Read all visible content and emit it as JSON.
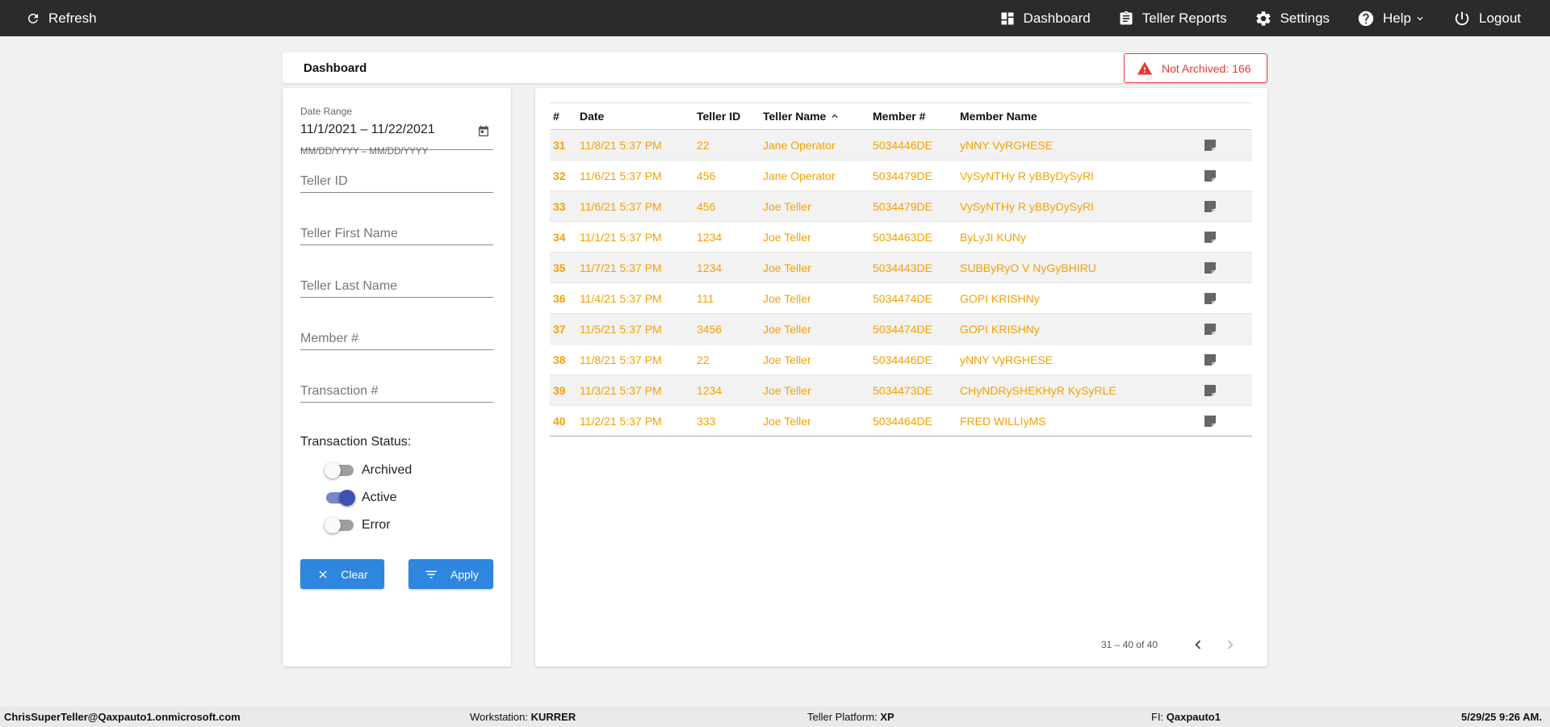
{
  "topbar": {
    "refresh_label": "Refresh",
    "nav": [
      {
        "label": "Dashboard",
        "icon": "dashboard-icon"
      },
      {
        "label": "Teller Reports",
        "icon": "clipboard-icon"
      },
      {
        "label": "Settings",
        "icon": "gear-icon"
      },
      {
        "label": "Help",
        "icon": "help-icon"
      },
      {
        "label": "Logout",
        "icon": "power-icon"
      }
    ]
  },
  "header": {
    "title": "Dashboard",
    "alert_label": "Not Archived: 166",
    "alert_color": "#e53935"
  },
  "filters": {
    "date_range_label": "Date Range",
    "date_range_value": "11/1/2021 – 11/22/2021",
    "date_range_hint": "MM/DD/YYYY – MM/DD/YYYY",
    "teller_id_placeholder": "Teller ID",
    "teller_first_name_placeholder": "Teller First Name",
    "teller_last_name_placeholder": "Teller Last Name",
    "member_placeholder": "Member #",
    "transaction_placeholder": "Transaction #",
    "status_label": "Transaction Status:",
    "statuses": [
      {
        "label": "Archived",
        "on": false
      },
      {
        "label": "Active",
        "on": true
      },
      {
        "label": "Error",
        "on": false
      }
    ],
    "clear_label": "Clear",
    "apply_label": "Apply"
  },
  "table": {
    "columns": [
      "#",
      "Date",
      "Teller ID",
      "Teller Name",
      "Member #",
      "Member Name"
    ],
    "sort_column": "Teller Name",
    "sort_direction": "ascending",
    "row_color": "#f5a100",
    "rows": [
      {
        "num": "31",
        "date": "11/8/21 5:37 PM",
        "teller_id": "22",
        "teller_name": "Jane Operator",
        "member": "5034446DE",
        "member_name": "yNNY VyRGHESE"
      },
      {
        "num": "32",
        "date": "11/6/21 5:37 PM",
        "teller_id": "456",
        "teller_name": "Jane Operator",
        "member": "5034479DE",
        "member_name": "VySyNTHy R yBByDySyRI"
      },
      {
        "num": "33",
        "date": "11/6/21 5:37 PM",
        "teller_id": "456",
        "teller_name": "Joe Teller",
        "member": "5034479DE",
        "member_name": "VySyNTHy R yBByDySyRI"
      },
      {
        "num": "34",
        "date": "11/1/21 5:37 PM",
        "teller_id": "1234",
        "teller_name": "Joe Teller",
        "member": "5034463DE",
        "member_name": "ByLyJI KUNy"
      },
      {
        "num": "35",
        "date": "11/7/21 5:37 PM",
        "teller_id": "1234",
        "teller_name": "Joe Teller",
        "member": "5034443DE",
        "member_name": "SUBByRyO V NyGyBHIRU"
      },
      {
        "num": "36",
        "date": "11/4/21 5:37 PM",
        "teller_id": "111",
        "teller_name": "Joe Teller",
        "member": "5034474DE",
        "member_name": "GOPI KRISHNy"
      },
      {
        "num": "37",
        "date": "11/5/21 5:37 PM",
        "teller_id": "3456",
        "teller_name": "Joe Teller",
        "member": "5034474DE",
        "member_name": "GOPI KRISHNy"
      },
      {
        "num": "38",
        "date": "11/8/21 5:37 PM",
        "teller_id": "22",
        "teller_name": "Joe Teller",
        "member": "5034446DE",
        "member_name": "yNNY VyRGHESE"
      },
      {
        "num": "39",
        "date": "11/3/21 5:37 PM",
        "teller_id": "1234",
        "teller_name": "Joe Teller",
        "member": "5034473DE",
        "member_name": "CHyNDRySHEKHyR KySyRLE"
      },
      {
        "num": "40",
        "date": "11/2/21 5:37 PM",
        "teller_id": "333",
        "teller_name": "Joe Teller",
        "member": "5034464DE",
        "member_name": "FRED WILLIyMS"
      }
    ],
    "pagination": "31 – 40 of 40"
  },
  "footer": {
    "user": "ChrisSuperTeller@Qaxpauto1.onmicrosoft.com",
    "workstation_label": "Workstation: ",
    "workstation_value": "KURRER",
    "platform_label": "Teller Platform: ",
    "platform_value": "XP",
    "fi_label": "FI: ",
    "fi_value": "Qaxpauto1",
    "datetime": "5/29/25 9:26 AM."
  }
}
